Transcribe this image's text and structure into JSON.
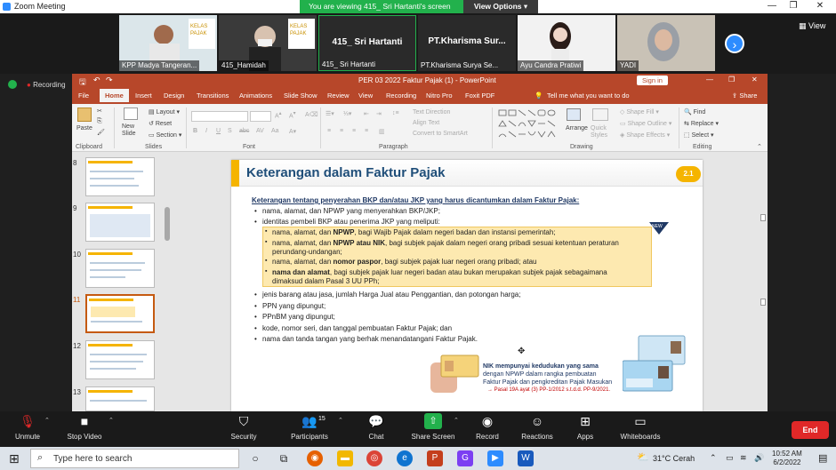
{
  "zoom": {
    "window_title": "Zoom Meeting",
    "banner_text": "You are viewing 415_ Sri Hartanti's screen",
    "view_options_label": "View Options",
    "view_label": "View",
    "recording_label": "Recording",
    "participants": [
      {
        "name": "KPP Madya Tangeran..."
      },
      {
        "name": "415_Hamidah"
      },
      {
        "name": "415_ Sri Hartanti",
        "big_label": "415_ Sri Hartanti"
      },
      {
        "name": "PT.Kharisma Surya Se...",
        "big_label": "PT.Kharisma  Sur..."
      },
      {
        "name": "Ayu Candra Pratiwi"
      },
      {
        "name": "YADI"
      }
    ],
    "toolbar": {
      "unmute": "Unmute",
      "stop_video": "Stop Video",
      "security": "Security",
      "participants": "Participants",
      "participants_count": "15",
      "chat": "Chat",
      "share_screen": "Share Screen",
      "record": "Record",
      "reactions": "Reactions",
      "apps": "Apps",
      "whiteboards": "Whiteboards",
      "end": "End"
    }
  },
  "ppt": {
    "title": "PER 03 2022 Faktur Pajak (1)  -  PowerPoint",
    "sign_in": "Sign in",
    "tabs": [
      "File",
      "Home",
      "Insert",
      "Design",
      "Transitions",
      "Animations",
      "Slide Show",
      "Review",
      "View",
      "Recording",
      "Nitro Pro",
      "Foxit PDF"
    ],
    "tell_me": "Tell me what you want to do",
    "share": "Share",
    "ribbon": {
      "paste": "Paste",
      "clipboard": "Clipboard",
      "new_slide": "New Slide",
      "layout": "Layout",
      "reset": "Reset",
      "section": "Section",
      "slides": "Slides",
      "font": "Font",
      "paragraph": "Paragraph",
      "text_direction": "Text Direction",
      "align_text": "Align Text",
      "convert_smartart": "Convert to SmartArt",
      "arrange": "Arrange",
      "quick_styles": "Quick Styles",
      "drawing": "Drawing",
      "shape_fill": "Shape Fill",
      "shape_outline": "Shape Outline",
      "shape_effects": "Shape Effects",
      "find": "Find",
      "replace": "Replace",
      "select": "Select",
      "editing": "Editing"
    },
    "slide_numbers": [
      "8",
      "9",
      "10",
      "11",
      "12",
      "13"
    ],
    "slide": {
      "title": "Keterangan dalam Faktur Pajak",
      "badge": "2.1",
      "new_tag": "NEW",
      "heading": "Keterangan tentang penyerahan BKP dan/atau JKP yang harus dicantumkan dalam Faktur Pajak:",
      "bullet1": "nama, alamat, dan NPWP yang menyerahkan BKP/JKP;",
      "bullet2": "identitas pembeli BKP atau penerima JKP yang meliputi:",
      "sub1_pre": "nama, alamat, dan ",
      "sub1_bold": "NPWP",
      "sub1_post": ", bagi Wajib Pajak dalam negeri badan dan instansi pemerintah;",
      "sub2_pre": "nama, alamat, dan ",
      "sub2_bold": "NPWP atau NIK",
      "sub2_post": ", bagi subjek pajak dalam negeri orang pribadi sesuai ketentuan peraturan",
      "sub2_cont": "perundang-undangan;",
      "sub3_pre": "nama, alamat, dan ",
      "sub3_bold": "nomor paspor",
      "sub3_post": ", bagi subjek pajak luar negeri orang pribadi; atau",
      "sub4_bold": "nama dan alamat",
      "sub4_post": ", bagi subjek pajak luar negeri badan atau bukan merupakan subjek pajak sebagaimana",
      "sub4_cont": "dimaksud dalam Pasal 3 UU PPh;",
      "bullet3": "jenis barang atau jasa, jumlah Harga Jual atau Penggantian, dan potongan harga;",
      "bullet4": "PPN yang dipungut;",
      "bullet5": "PPnBM yang dipungut;",
      "bullet6": "kode, nomor seri, dan tanggal pembuatan Faktur Pajak; dan",
      "bullet7": "nama dan tanda tangan yang berhak menandatangani Faktur Pajak.",
      "nik_line1": "NIK mempunyai kedudukan yang sama",
      "nik_line2": "dengan NPWP dalam rangka pembuatan",
      "nik_line3": "Faktur Pajak dan pengkreditan Pajak Masukan",
      "nik_ref": "→ Pasal 19A ayat (3) PP-1/2012 s.t.d.d. PP-9/2021."
    }
  },
  "taskbar": {
    "search_placeholder": "Type here to search",
    "weather": "31°C  Cerah",
    "time": "10:52 AM",
    "date": "6/2/2022"
  }
}
